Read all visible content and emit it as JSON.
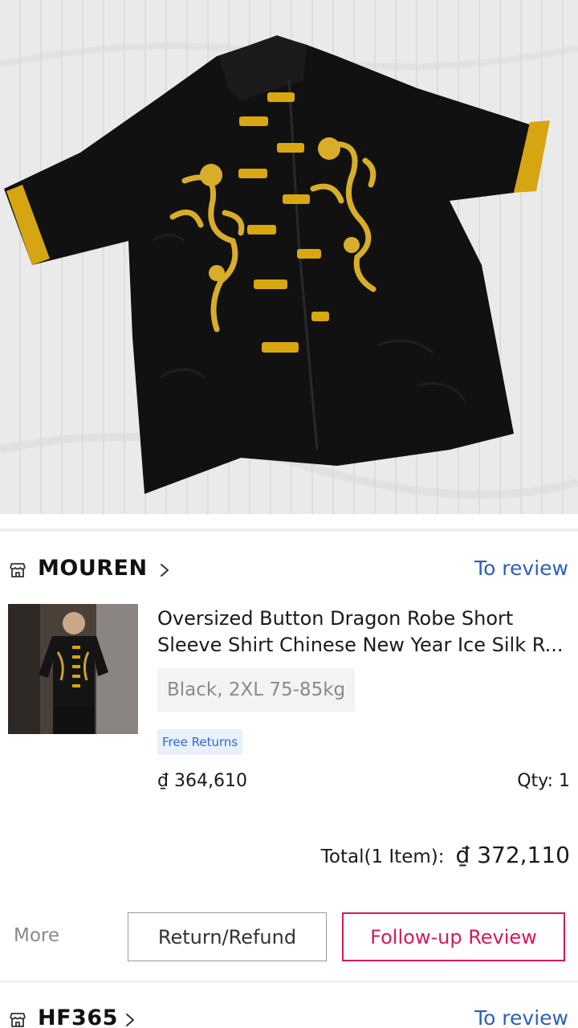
{
  "colors": {
    "link_blue": "#2f5fba",
    "review_pink": "#d4195f",
    "badge_blue": "#2f6bd0",
    "muted_gray": "#8a8a8e"
  },
  "review_photo": {
    "icon": "photo-of-black-dragon-shirt"
  },
  "orders": [
    {
      "shop": {
        "icon": "shop-icon",
        "name": "MOUREN",
        "action": "To review"
      },
      "product": {
        "title_line1": "Oversized Button Dragon Robe Short",
        "title_line2": "Sleeve Shirt Chinese New Year Ice Silk R...",
        "variant": "Black, 2XL 75-85kg",
        "badge": "Free Returns",
        "price": "₫ 364,610",
        "qty": "Qty: 1"
      },
      "total": {
        "label": "Total(1 Item):",
        "amount": "₫ 372,110"
      },
      "actions": {
        "more": "More",
        "return_refund": "Return/Refund",
        "follow_up_review": "Follow-up Review"
      }
    },
    {
      "shop": {
        "icon": "shop-icon",
        "name": "HF365",
        "action": "To review"
      }
    }
  ]
}
